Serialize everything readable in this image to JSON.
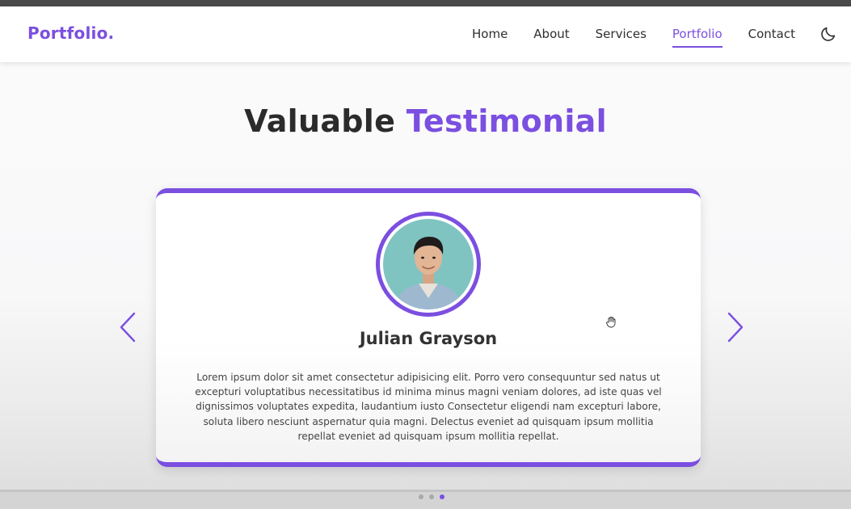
{
  "header": {
    "logo": "Portfolio.",
    "nav": [
      {
        "label": "Home",
        "active": false
      },
      {
        "label": "About",
        "active": false
      },
      {
        "label": "Services",
        "active": false
      },
      {
        "label": "Portfolio",
        "active": true
      },
      {
        "label": "Contact",
        "active": false
      }
    ],
    "theme_toggle_icon": "moon-icon"
  },
  "section": {
    "title_plain": "Valuable",
    "title_accent": "Testimonial"
  },
  "testimonial": {
    "name": "Julian Grayson",
    "avatar_icon": "person-avatar",
    "text": "Lorem ipsum dolor sit amet consectetur adipisicing elit. Porro vero consequuntur sed natus ut excepturi voluptatibus necessitatibus id minima minus magni veniam dolores, ad iste quas vel dignissimos voluptates expedita, laudantium iusto Consectetur eligendi nam excepturi labore, soluta libero nesciunt aspernatur quia magni. Delectus eveniet ad quisquam ipsum mollitia repellat eveniet ad quisquam ipsum mollitia repellat."
  },
  "carousel": {
    "prev_icon": "chevron-left-icon",
    "next_icon": "chevron-right-icon",
    "slide_count": 3,
    "active_slide": 3
  },
  "colors": {
    "accent": "#7b4fe0",
    "text_dark": "#2b2b2b"
  }
}
